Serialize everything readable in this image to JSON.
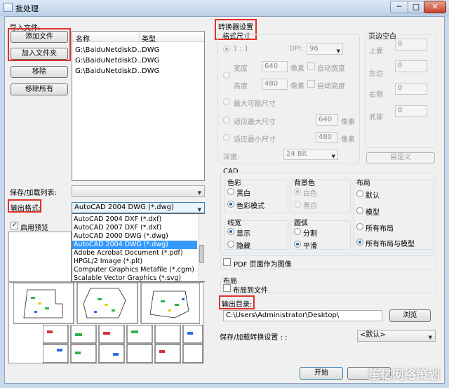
{
  "window": {
    "title": "批处理",
    "min_label": "─",
    "max_label": "□",
    "close_label": "✕",
    "icon": "app-icon"
  },
  "import": {
    "label": "导入文件:",
    "add_file": "添加文件",
    "add_folder": "加入文件夹",
    "remove": "移除",
    "remove_all": "移除所有",
    "columns": [
      "名称",
      "类型"
    ],
    "files": [
      {
        "name": "G:\\BaiduNetdiskD...",
        "type": "DWG"
      },
      {
        "name": "G:\\BaiduNetdiskD...",
        "type": "DWG"
      },
      {
        "name": "G:\\BaiduNetdiskD...",
        "type": "DWG"
      }
    ]
  },
  "save_load_list": {
    "label": "保存/加载列表:",
    "value": ""
  },
  "output_format": {
    "label": "输出格式:",
    "selected": "AutoCAD 2004 DWG (*.dwg)",
    "options": [
      "AutoCAD 2004 DXF (*.dxf)",
      "AutoCAD 2007 DXF (*.dxf)",
      "AutoCAD 2000 DWG (*.dwg)",
      "AutoCAD 2004 DWG (*.dwg)",
      "Adobe Acrobat Document (*.pdf)",
      "HPGL/2 Image (*.plt)",
      "Computer Graphics Metafile (*.cgm)",
      "Scalable Vector Graphics (*.svg)"
    ],
    "selected_index": 3
  },
  "preview": {
    "label": "启用预览",
    "checked": true
  },
  "converter": {
    "title": "转换器设置",
    "format_size": "格式尺寸",
    "one_to_one": "1 : 1",
    "dpi_label": "DPI:",
    "dpi_value": "96",
    "width_label": "宽度",
    "width_value": "640",
    "height_label": "高度",
    "height_value": "480",
    "pixel": "像素",
    "auto_width": "自动宽度",
    "auto_height": "自动高度",
    "max_size": "最大可能尺寸",
    "fit_max": "适应最大尺寸",
    "fit_max_value": "640",
    "fit_min": "适应最小尺寸",
    "fit_min_value": "480",
    "depth_label": "深度:",
    "depth_value": "24 Bit"
  },
  "margins": {
    "title": "页边空白",
    "top": "上面",
    "left": "左边",
    "right": "右侧",
    "bottom": "底部",
    "top_v": "0",
    "left_v": "0",
    "right_v": "0",
    "bottom_v": "0",
    "custom": "自定义"
  },
  "cad": {
    "title": "CAD",
    "color": "色彩",
    "black_white": "黑白",
    "color_mode": "色彩模式",
    "background": "背景色",
    "white": "白色",
    "black": "黑白",
    "layout": "布局",
    "default": "默认",
    "model": "模型",
    "all_layouts": "所有布局",
    "all_layouts_model": "所有布局与模型",
    "lineweight": "线宽",
    "show": "显示",
    "hide": "隐藏",
    "arc": "圆弧",
    "segment": "分割",
    "smooth": "平滑"
  },
  "pdf_image": "PDF 页面作为图像",
  "layout_group": {
    "title": "布局",
    "layout_to_file": "布局到文件"
  },
  "output_dir": {
    "label": "输出目录:",
    "value": "C:\\Users\\Administrator\\Desktop\\",
    "browse": "浏览"
  },
  "save_settings": {
    "label": "保存/加载转换设置 : :",
    "value": "<默认>"
  },
  "start": "开始",
  "watermark": "笙亿网络策划"
}
